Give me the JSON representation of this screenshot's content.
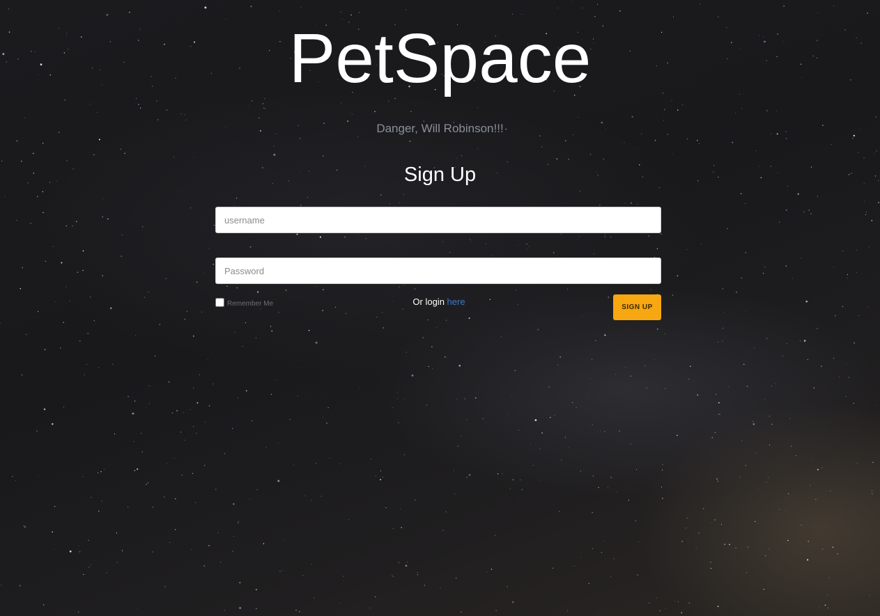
{
  "brand": {
    "title": "PetSpace"
  },
  "tagline": "Danger, Will Robinson!!!",
  "form": {
    "title": "Sign Up",
    "username_placeholder": "username",
    "password_placeholder": "Password",
    "remember_label": "Remember Me",
    "login_prefix": "Or login ",
    "login_link": "here",
    "submit_label": "SIGN UP"
  },
  "colors": {
    "accent": "#f7a711",
    "link": "#3f79c9",
    "tagline": "#8a8f99"
  }
}
